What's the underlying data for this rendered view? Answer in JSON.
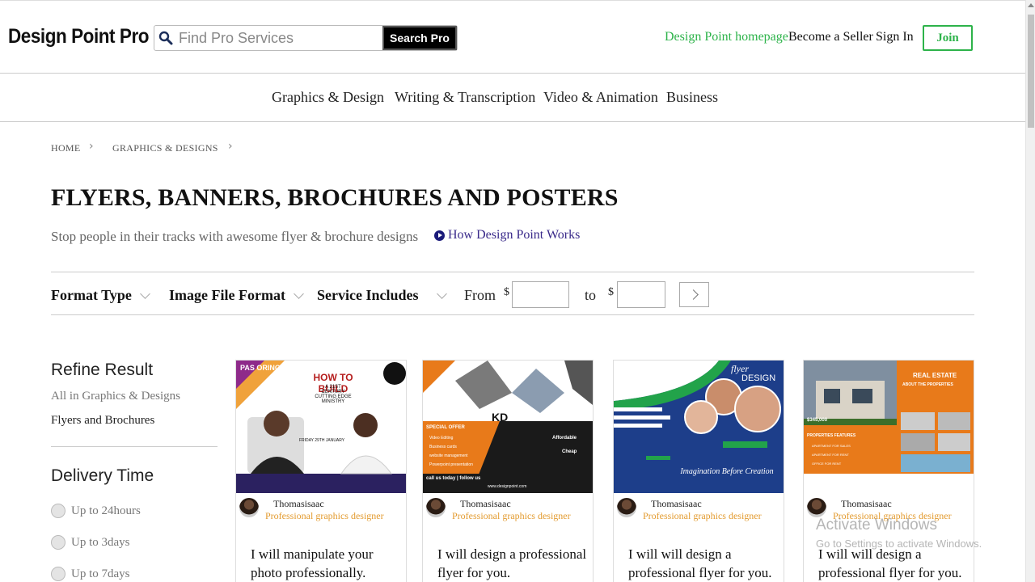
{
  "header": {
    "logo": "Design Point Pro",
    "search_placeholder": "Find Pro Services",
    "search_button": "Search Pro",
    "homepage_link": "Design Point homepage",
    "seller_link": "Become a Seller",
    "signin_link": "Sign In",
    "join_button": "Join"
  },
  "categories": [
    "Graphics & Design",
    "Writing & Transcription",
    "Video & Animation",
    "Business"
  ],
  "breadcrumb": [
    "HOME",
    "GRAPHICS & DESIGNS"
  ],
  "page": {
    "title": "FLYERS, BANNERS, BROCHURES AND POSTERS",
    "subtitle": "Stop people in their tracks with awesome flyer & brochure designs",
    "how_link": "How Design Point Works"
  },
  "filters": {
    "format_type": "Format Type",
    "image_file_format": "Image File Format",
    "service_includes": "Service Includes",
    "from_label": "From",
    "to_label": "to",
    "currency": "$"
  },
  "sidebar": {
    "refine_heading": "Refine Result",
    "all_link": "All in Graphics & Designs",
    "current_link": "Flyers and Brochures",
    "delivery_heading": "Delivery Time",
    "delivery_options": [
      "Up to 24hours",
      "Up to 3days",
      "Up to 7days"
    ]
  },
  "cards": [
    {
      "seller": "Thomasisaac",
      "role": "Professional graphics designer",
      "title": "I will manipulate your photo professionally."
    },
    {
      "seller": "Thomasisaac",
      "role": "Professional graphics designer",
      "title": "I will design a professional flyer for you."
    },
    {
      "seller": "Thomasisaac",
      "role": "Professional graphics designer",
      "title": "I will will design a professional flyer for you."
    },
    {
      "seller": "Thomasisaac",
      "role": "Professional graphics designer",
      "title": "I will will design a professional flyer for you."
    }
  ],
  "thumb_text": {
    "c1_brand": "PAS ORINO",
    "c1_headline": "HOW TO BUILD",
    "c1_sub": "A 21ST CENTURY CUTTING EDGE MINISTRY",
    "c1_date": "FRIDAY 29TH JANUARY",
    "c2_brand": "KD",
    "c2_offer": "SPECIAL OFFER",
    "c2_items": [
      "Video Editing",
      "Business cards",
      "website management",
      "Powerpoint presentation"
    ],
    "c2_tag1": "Affordable",
    "c2_tag2": "Cheap",
    "c2_footer": "call us today | follow us",
    "c2_site": "www.designpoint.com",
    "c3_script": "flyer",
    "c3_design": "DESIGN",
    "c3_slogan": "Imagination Before Creation",
    "c4_title": "REAL ESTATE",
    "c4_about": "ABOUT THE PROPERTIES",
    "c4_price": "$345,000",
    "c4_features": "PROPERTIES FEATURES",
    "c4_items": [
      "APARTMENT FOR SALES",
      "APARTMENT FOR RENT",
      "OFFICE FOR RENT"
    ]
  },
  "watermark": {
    "line1": "Activate Windows",
    "line2": "Go to Settings to activate Windows."
  }
}
